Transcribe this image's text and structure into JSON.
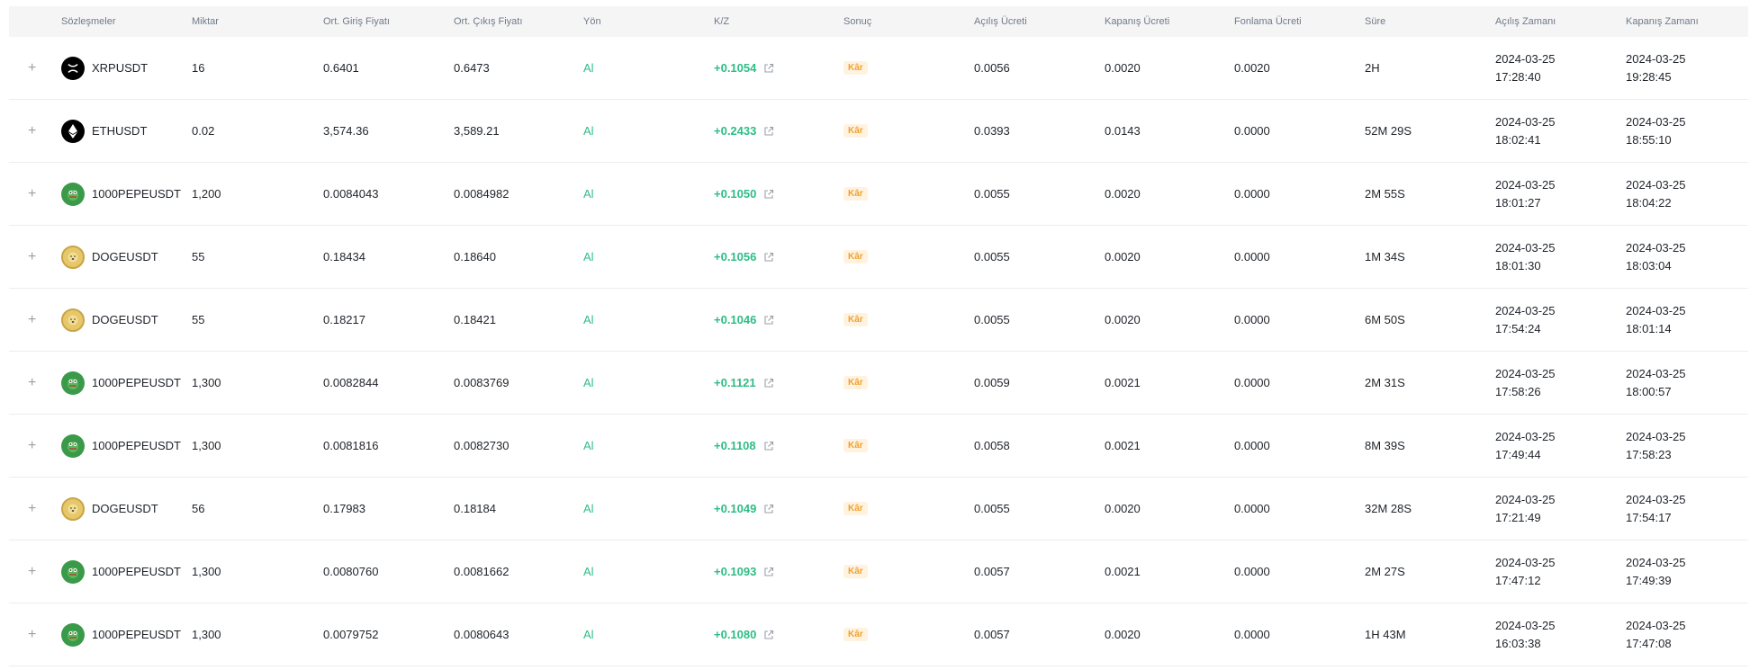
{
  "headers": [
    "Sözleşmeler",
    "Miktar",
    "Ort. Giriş Fiyatı",
    "Ort. Çıkış Fiyatı",
    "Yön",
    "K/Z",
    "Sonuç",
    "Açılış Ücreti",
    "Kapanış Ücreti",
    "Fonlama Ücreti",
    "Süre",
    "Açılış Zamanı",
    "Kapanış Zamanı"
  ],
  "colors": {
    "positive": "#2ebd85",
    "badge_text": "#f0a030",
    "badge_bg": "#fff3e0"
  },
  "rows": [
    {
      "expand": "+",
      "icon": "xrp-icon",
      "symbol": "XRPUSDT",
      "qty": "16",
      "entry": "0.6401",
      "exit": "0.6473",
      "side": "Al",
      "pnl": "+0.1054",
      "result": "Kâr",
      "open_fee": "0.0056",
      "close_fee": "0.0020",
      "funding_fee": "0.0020",
      "duration": "2H",
      "open_date": "2024-03-25",
      "open_time": "17:28:40",
      "close_date": "2024-03-25",
      "close_time": "19:28:45"
    },
    {
      "expand": "+",
      "icon": "eth-icon",
      "symbol": "ETHUSDT",
      "qty": "0.02",
      "entry": "3,574.36",
      "exit": "3,589.21",
      "side": "Al",
      "pnl": "+0.2433",
      "result": "Kâr",
      "open_fee": "0.0393",
      "close_fee": "0.0143",
      "funding_fee": "0.0000",
      "duration": "52M 29S",
      "open_date": "2024-03-25",
      "open_time": "18:02:41",
      "close_date": "2024-03-25",
      "close_time": "18:55:10"
    },
    {
      "expand": "+",
      "icon": "pepe-icon",
      "symbol": "1000PEPEUSDT",
      "qty": "1,200",
      "entry": "0.0084043",
      "exit": "0.0084982",
      "side": "Al",
      "pnl": "+0.1050",
      "result": "Kâr",
      "open_fee": "0.0055",
      "close_fee": "0.0020",
      "funding_fee": "0.0000",
      "duration": "2M 55S",
      "open_date": "2024-03-25",
      "open_time": "18:01:27",
      "close_date": "2024-03-25",
      "close_time": "18:04:22"
    },
    {
      "expand": "+",
      "icon": "doge-icon",
      "symbol": "DOGEUSDT",
      "qty": "55",
      "entry": "0.18434",
      "exit": "0.18640",
      "side": "Al",
      "pnl": "+0.1056",
      "result": "Kâr",
      "open_fee": "0.0055",
      "close_fee": "0.0020",
      "funding_fee": "0.0000",
      "duration": "1M 34S",
      "open_date": "2024-03-25",
      "open_time": "18:01:30",
      "close_date": "2024-03-25",
      "close_time": "18:03:04"
    },
    {
      "expand": "+",
      "icon": "doge-icon",
      "symbol": "DOGEUSDT",
      "qty": "55",
      "entry": "0.18217",
      "exit": "0.18421",
      "side": "Al",
      "pnl": "+0.1046",
      "result": "Kâr",
      "open_fee": "0.0055",
      "close_fee": "0.0020",
      "funding_fee": "0.0000",
      "duration": "6M 50S",
      "open_date": "2024-03-25",
      "open_time": "17:54:24",
      "close_date": "2024-03-25",
      "close_time": "18:01:14"
    },
    {
      "expand": "+",
      "icon": "pepe-icon",
      "symbol": "1000PEPEUSDT",
      "qty": "1,300",
      "entry": "0.0082844",
      "exit": "0.0083769",
      "side": "Al",
      "pnl": "+0.1121",
      "result": "Kâr",
      "open_fee": "0.0059",
      "close_fee": "0.0021",
      "funding_fee": "0.0000",
      "duration": "2M 31S",
      "open_date": "2024-03-25",
      "open_time": "17:58:26",
      "close_date": "2024-03-25",
      "close_time": "18:00:57"
    },
    {
      "expand": "+",
      "icon": "pepe-icon",
      "symbol": "1000PEPEUSDT",
      "qty": "1,300",
      "entry": "0.0081816",
      "exit": "0.0082730",
      "side": "Al",
      "pnl": "+0.1108",
      "result": "Kâr",
      "open_fee": "0.0058",
      "close_fee": "0.0021",
      "funding_fee": "0.0000",
      "duration": "8M 39S",
      "open_date": "2024-03-25",
      "open_time": "17:49:44",
      "close_date": "2024-03-25",
      "close_time": "17:58:23"
    },
    {
      "expand": "+",
      "icon": "doge-icon",
      "symbol": "DOGEUSDT",
      "qty": "56",
      "entry": "0.17983",
      "exit": "0.18184",
      "side": "Al",
      "pnl": "+0.1049",
      "result": "Kâr",
      "open_fee": "0.0055",
      "close_fee": "0.0020",
      "funding_fee": "0.0000",
      "duration": "32M 28S",
      "open_date": "2024-03-25",
      "open_time": "17:21:49",
      "close_date": "2024-03-25",
      "close_time": "17:54:17"
    },
    {
      "expand": "+",
      "icon": "pepe-icon",
      "symbol": "1000PEPEUSDT",
      "qty": "1,300",
      "entry": "0.0080760",
      "exit": "0.0081662",
      "side": "Al",
      "pnl": "+0.1093",
      "result": "Kâr",
      "open_fee": "0.0057",
      "close_fee": "0.0021",
      "funding_fee": "0.0000",
      "duration": "2M 27S",
      "open_date": "2024-03-25",
      "open_time": "17:47:12",
      "close_date": "2024-03-25",
      "close_time": "17:49:39"
    },
    {
      "expand": "+",
      "icon": "pepe-icon",
      "symbol": "1000PEPEUSDT",
      "qty": "1,300",
      "entry": "0.0079752",
      "exit": "0.0080643",
      "side": "Al",
      "pnl": "+0.1080",
      "result": "Kâr",
      "open_fee": "0.0057",
      "close_fee": "0.0020",
      "funding_fee": "0.0000",
      "duration": "1H 43M",
      "open_date": "2024-03-25",
      "open_time": "16:03:38",
      "close_date": "2024-03-25",
      "close_time": "17:47:08"
    }
  ]
}
